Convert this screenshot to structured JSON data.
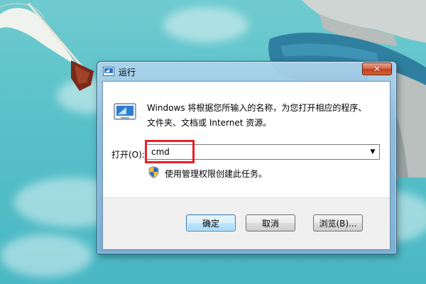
{
  "window": {
    "title": "运行",
    "close_symbol": "✕"
  },
  "dialog": {
    "description_line1": "Windows 将根据您所输入的名称，为您打开相应的程序、",
    "description_line2": "文件夹、文档或 Internet 资源。",
    "open_label": "打开(O):",
    "input_value": "cmd",
    "dropdown_symbol": "▼",
    "admin_note": "使用管理权限创建此任务。"
  },
  "buttons": {
    "ok": "确定",
    "cancel": "取消",
    "browse": "浏览(B)..."
  },
  "icons": {
    "app": "run-app-icon",
    "run": "run-dialog-icon",
    "shield": "uac-shield-icon",
    "close": "close-icon",
    "dropdown": "chevron-down-icon"
  },
  "colors": {
    "highlight": "#e8202a",
    "title_bar": "#8dbcde",
    "close_button": "#c3401f",
    "wallpaper": "#58c0c9"
  }
}
